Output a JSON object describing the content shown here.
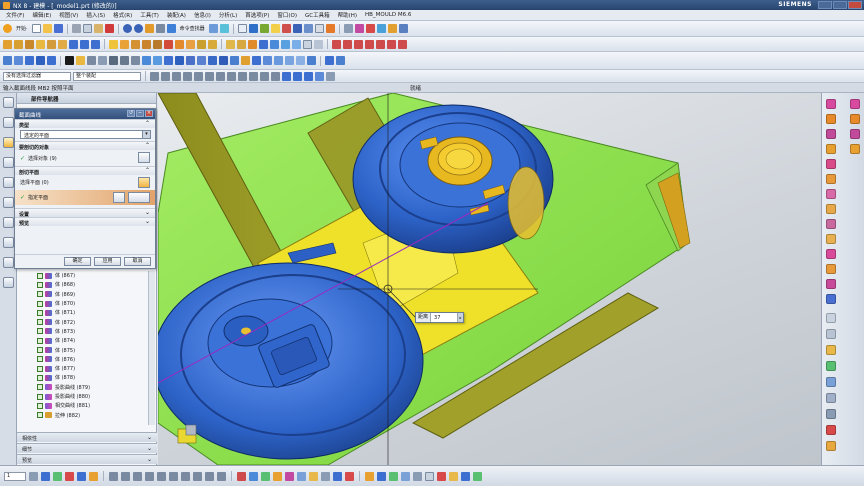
{
  "window": {
    "title": "NX 8 - 建模 - [_model1.prt (修改的)]",
    "brand": "SIEMENS"
  },
  "menu": [
    "文件(F)",
    "编辑(E)",
    "视图(V)",
    "插入(S)",
    "格式(R)",
    "工具(T)",
    "装配(A)",
    "信息(I)",
    "分析(L)",
    "首选项(P)",
    "窗口(O)",
    "GC工具箱",
    "帮助(H)",
    "HB_MOULD M6.6"
  ],
  "toolbar": {
    "start_label": "开始·",
    "command_finder_label": "命令查找器",
    "selection_filter": "没有选择过滤器",
    "assembly_scope": "整个装配"
  },
  "cue_line": {
    "prompt": "输入截面线段 MB2 按照平面",
    "status": "就绪"
  },
  "navigator": {
    "title": "部件导航器",
    "rows": [
      {
        "label": "体 (867)",
        "kind": "body"
      },
      {
        "label": "体 (868)",
        "kind": "body"
      },
      {
        "label": "体 (869)",
        "kind": "body"
      },
      {
        "label": "体 (870)",
        "kind": "body"
      },
      {
        "label": "体 (871)",
        "kind": "body"
      },
      {
        "label": "体 (872)",
        "kind": "body"
      },
      {
        "label": "体 (873)",
        "kind": "body"
      },
      {
        "label": "体 (874)",
        "kind": "body"
      },
      {
        "label": "体 (875)",
        "kind": "body"
      },
      {
        "label": "体 (876)",
        "kind": "body"
      },
      {
        "label": "体 (877)",
        "kind": "body"
      },
      {
        "label": "体 (878)",
        "kind": "body"
      },
      {
        "label": "投影曲线 (879)",
        "kind": "curve"
      },
      {
        "label": "投影曲线 (880)",
        "kind": "curve"
      },
      {
        "label": "相交曲线 (881)",
        "kind": "curve"
      },
      {
        "label": "拉伸 (882)",
        "kind": "extrude"
      }
    ],
    "footer": [
      "相依性",
      "细节",
      "预览"
    ]
  },
  "dialog": {
    "title": "截面曲线",
    "type_group": "类型",
    "type_value": "选定的平面",
    "objects_group": "要剖切的对象",
    "select_object": "选择对象 (9)",
    "planes_group": "剖切平面",
    "select_plane": "选择平面 (0)",
    "specify_plane": "指定平面",
    "settings_group": "设置",
    "preview_group": "预览",
    "ok": "确定",
    "apply": "应用",
    "cancel": "取消"
  },
  "graphics": {
    "distance_label": "距离",
    "distance_value": "37",
    "colors": {
      "blue_part": "#2d63c8",
      "green_plate": "#8be04a",
      "yellow_body": "#efe12a",
      "olive_plane": "#9a9a28",
      "gold_face": "#e8b820"
    }
  }
}
